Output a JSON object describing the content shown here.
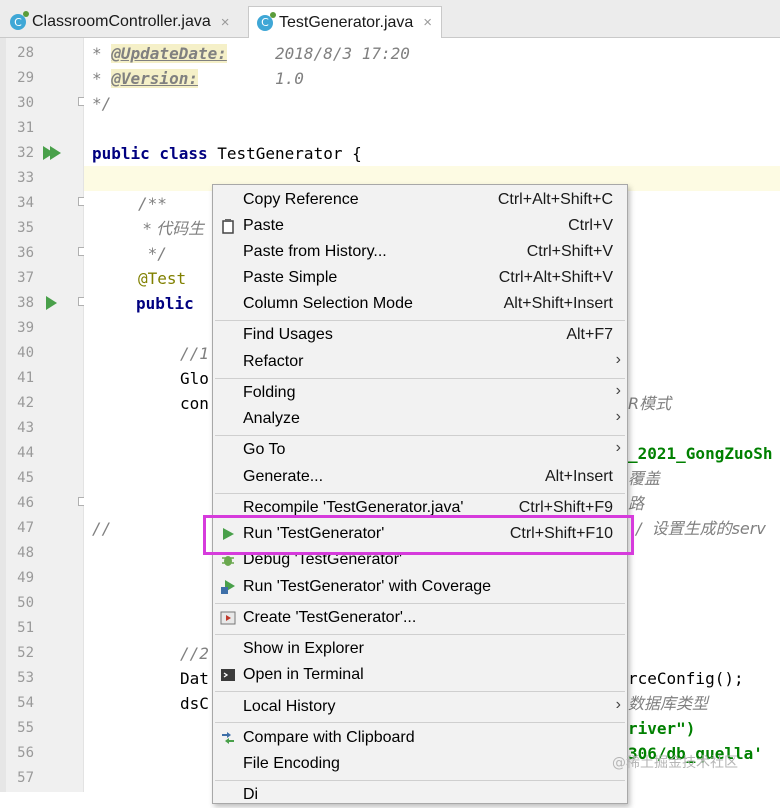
{
  "tabs": [
    {
      "label": "ClassroomController.java",
      "close": "×"
    },
    {
      "label": "TestGenerator.java",
      "close": "×"
    }
  ],
  "line_numbers": [
    "28",
    "29",
    "30",
    "31",
    "32",
    "33",
    "34",
    "35",
    "36",
    "37",
    "38",
    "39",
    "40",
    "41",
    "42",
    "43",
    "44",
    "45",
    "46",
    "47",
    "48",
    "49",
    "50",
    "51",
    "52",
    "53",
    "54",
    "55",
    "56",
    "57"
  ],
  "code": {
    "l28_star": "* ",
    "l28_tag": "@UpdateDate:",
    "l28_val": "     2018/8/3 17:20",
    "l29_star": "* ",
    "l29_tag": "@Version:",
    "l29_val": "        1.0",
    "l30": "*/",
    "l32_kw": "public class ",
    "l32_rest": "TestGenerator {",
    "l34": "/**",
    "l35": " * 代码生",
    "l36": " */",
    "l37": "@Test",
    "l38": "public",
    "l40": "//1",
    "l41": "Glo",
    "l42": "con",
    "l42_right": "R模式",
    "l44_right": "_2021_GongZuoSh",
    "l45_right": "覆盖",
    "l46_right": "路",
    "l47_left": "//",
    "l47_right": "/  设置生成的serv",
    "l52": "//2",
    "l53": "Dat",
    "l53_right": "rceConfig();",
    "l54": "dsC",
    "l54_right": "数据库类型",
    "l55_right": "river\")",
    "l56_right": "306/db_quella'"
  },
  "menu": {
    "items": [
      {
        "label": "Copy Reference",
        "shortcut": "Ctrl+Alt+Shift+C"
      },
      {
        "label": "Paste",
        "shortcut": "Ctrl+V",
        "icon": "clipboard-icon"
      },
      {
        "label": "Paste from History...",
        "shortcut": "Ctrl+Shift+V"
      },
      {
        "label": "Paste Simple",
        "shortcut": "Ctrl+Alt+Shift+V"
      },
      {
        "label": "Column Selection Mode",
        "shortcut": "Alt+Shift+Insert"
      },
      {
        "label": "Find Usages",
        "shortcut": "Alt+F7"
      },
      {
        "label": "Refactor",
        "shortcut": ""
      },
      {
        "label": "Folding",
        "shortcut": ""
      },
      {
        "label": "Analyze",
        "shortcut": ""
      },
      {
        "label": "Go To",
        "shortcut": ""
      },
      {
        "label": "Generate...",
        "shortcut": "Alt+Insert"
      },
      {
        "label": "Recompile 'TestGenerator.java'",
        "shortcut": "Ctrl+Shift+F9"
      },
      {
        "label": "Run 'TestGenerator'",
        "shortcut": "Ctrl+Shift+F10",
        "icon": "run-icon"
      },
      {
        "label": "Debug 'TestGenerator'",
        "shortcut": "",
        "icon": "debug-icon"
      },
      {
        "label": "Run 'TestGenerator' with Coverage",
        "shortcut": "",
        "icon": "coverage-icon"
      },
      {
        "label": "Create 'TestGenerator'...",
        "shortcut": "",
        "icon": "create-config-icon"
      },
      {
        "label": "Show in Explorer",
        "shortcut": ""
      },
      {
        "label": "Open in Terminal",
        "shortcut": "",
        "icon": "terminal-icon"
      },
      {
        "label": "Local History",
        "shortcut": ""
      },
      {
        "label": "Compare with Clipboard",
        "shortcut": "",
        "icon": "compare-icon"
      },
      {
        "label": "File Encoding",
        "shortcut": ""
      },
      {
        "label": "Di",
        "shortcut": ""
      }
    ],
    "submenu_arrow": "›"
  },
  "watermark": "@稀土掘金技术社区",
  "colors": {
    "highlight_box": "#d63bdc",
    "run_green": "#49a04a"
  }
}
